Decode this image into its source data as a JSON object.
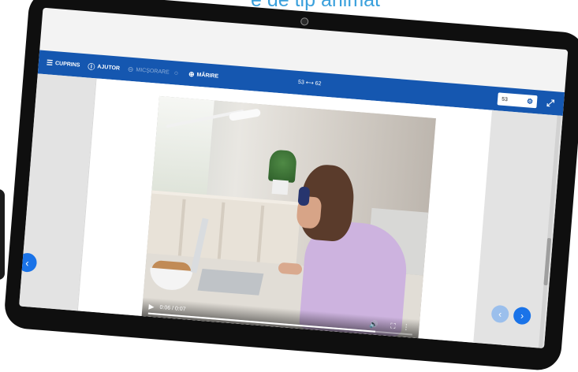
{
  "caption": "e de tip animat",
  "toolbar": {
    "items": [
      {
        "label": "CUPRINS",
        "icon": "list-icon"
      },
      {
        "label": "AJUTOR",
        "icon": "help-icon"
      },
      {
        "label": "MICȘORARE",
        "icon": "zoom-out-icon"
      },
      {
        "label": "MĂRIRE",
        "icon": "zoom-in-icon"
      }
    ],
    "pager": "53 ⟷ 62",
    "page_input": "53",
    "page_input_icon": "gear-icon",
    "fullscreen_icon": "fullscreen-icon"
  },
  "video": {
    "time": "0:06 / 0:07",
    "progress": 0.86,
    "play_icon": "play-icon",
    "volume_icon": "volume-icon",
    "fullscreen_icon": "fullscreen-icon",
    "more_icon": "more-icon"
  },
  "nav": {
    "prev_icon": "chevron-left-icon",
    "next_icon": "chevron-right-icon"
  },
  "colors": {
    "toolbar": "#1557b0",
    "nav_button": "#1a73e8",
    "caption": "#3aa0dc"
  }
}
